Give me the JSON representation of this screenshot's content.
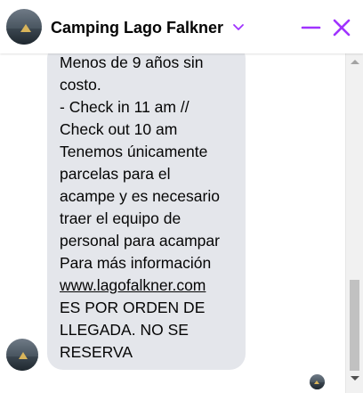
{
  "header": {
    "title": "Camping Lago Falkner",
    "icons": {
      "avatar": "camping-photo-avatar",
      "dropdown": "chevron-down-icon",
      "minimize": "minimize-icon",
      "close": "close-icon"
    },
    "accent_color": "#a033ff"
  },
  "message": {
    "lines": [
      "Menos de 9 años sin",
      "costo.",
      "- Check in 11 am //",
      "Check out 10 am",
      "Tenemos únicamente",
      "parcelas para el",
      "acampe y es necesario",
      "traer el equipo de",
      "personal para acampar",
      "Para más información"
    ],
    "link": "www.lagofalkner.com",
    "lines_after_link": [
      "ES POR ORDEN DE",
      "LLEGADA. NO SE",
      "RESERVA"
    ],
    "bubble_color": "#e4e6eb"
  },
  "scrollbar": {
    "thumb_color": "#c1c1c1"
  }
}
